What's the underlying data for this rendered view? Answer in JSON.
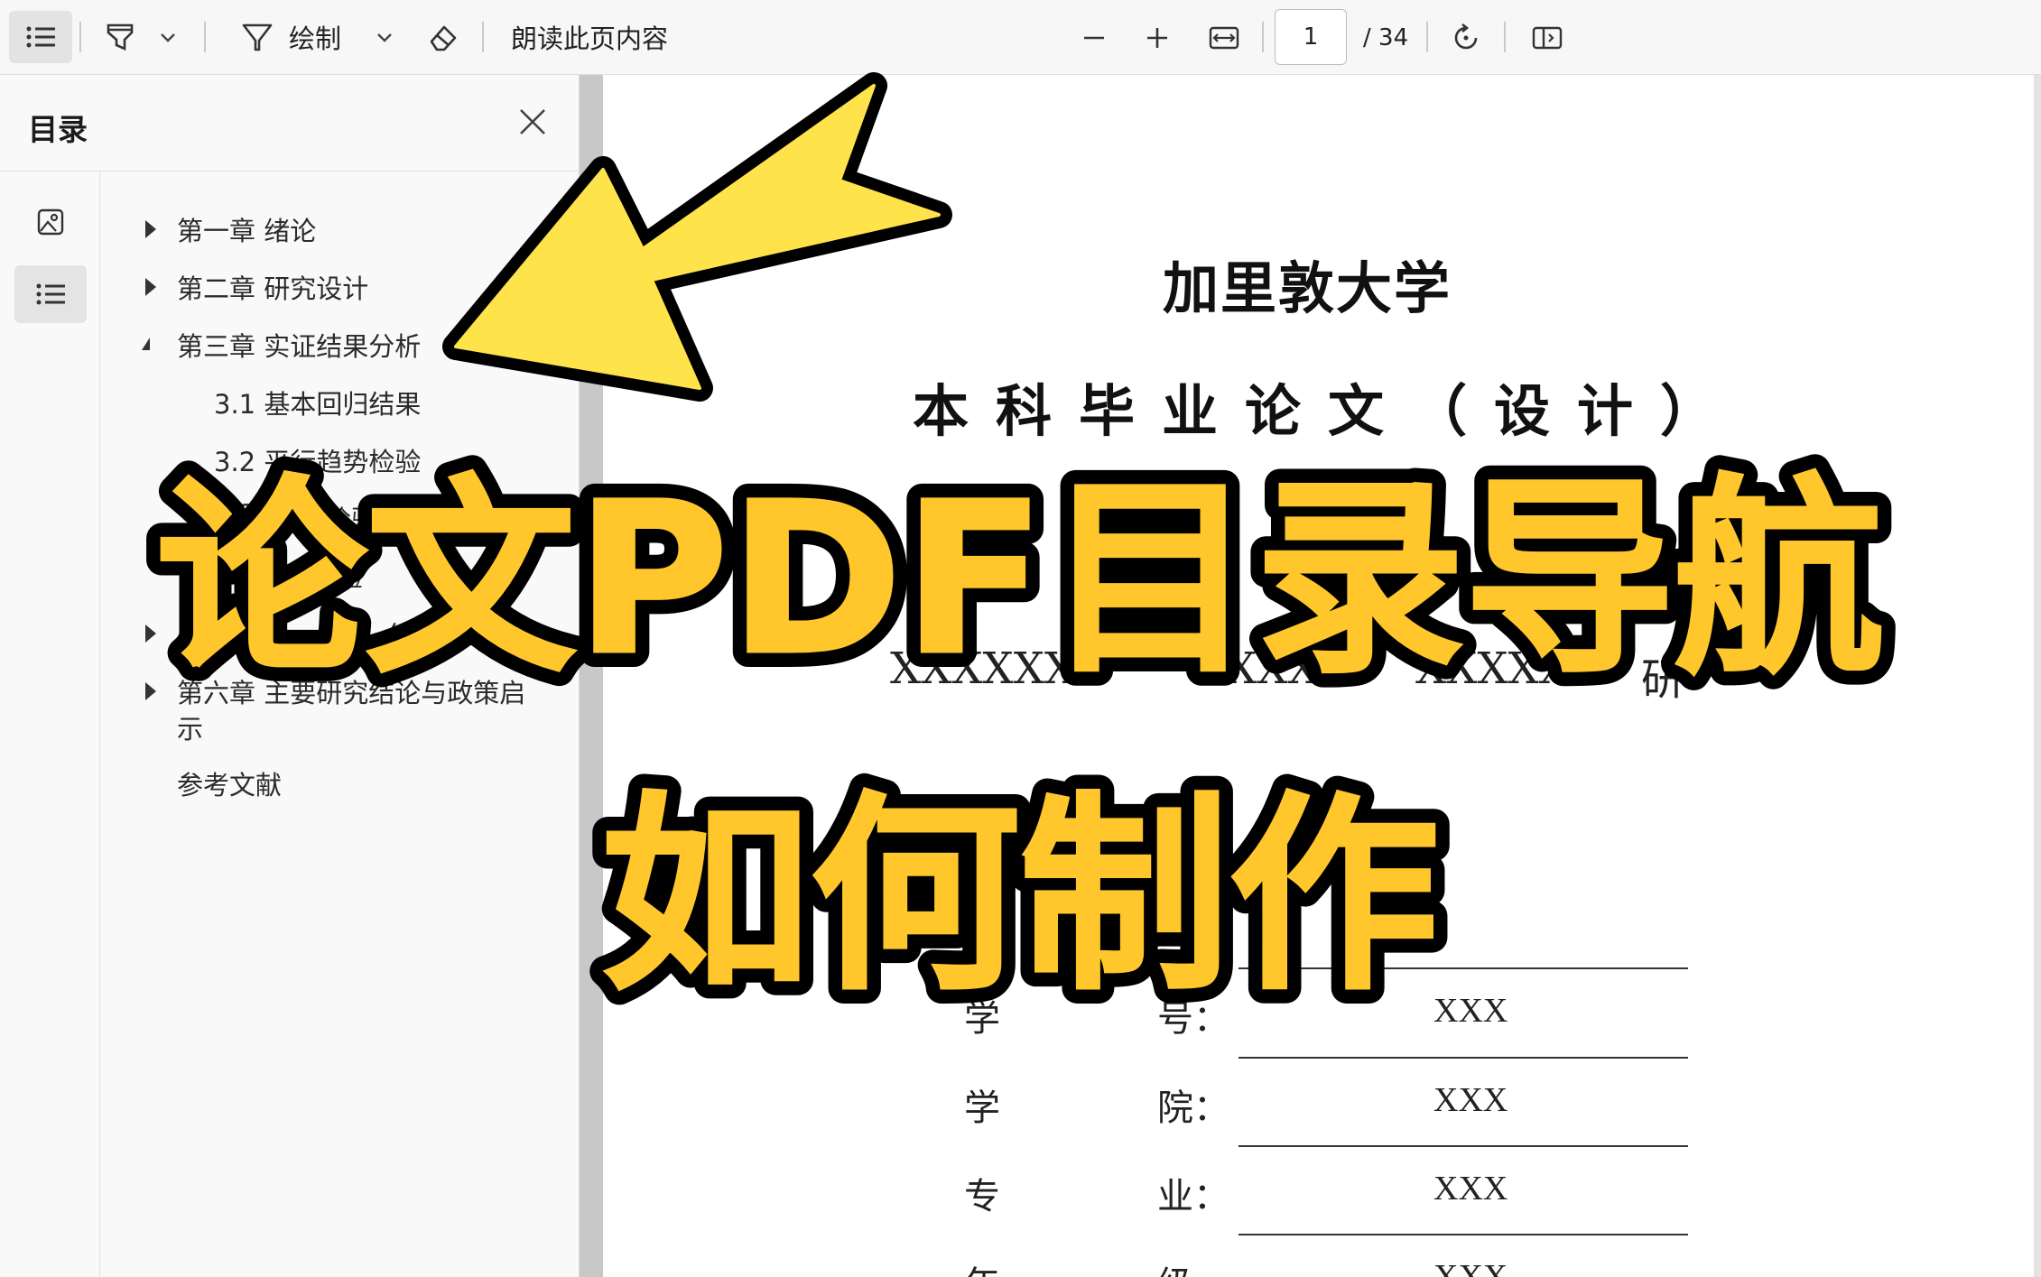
{
  "toolbar": {
    "draw_label": "绘制",
    "read_aloud_label": "朗读此页内容",
    "page_current": "1",
    "page_total": "/ 34",
    "icons": [
      "toc-icon",
      "highlight-icon",
      "chevron-down-icon",
      "draw-pen-icon",
      "eraser-icon",
      "zoom-out-icon",
      "zoom-in-icon",
      "fit-width-icon",
      "rotate-icon",
      "page-view-icon"
    ]
  },
  "sidebar": {
    "title": "目录",
    "items": [
      {
        "label": "第一章 绪论",
        "state": "collapsed"
      },
      {
        "label": "第二章 研究设计",
        "state": "collapsed"
      },
      {
        "label": "第三章 实证结果分析",
        "state": "expanded"
      },
      {
        "label": "3.1 基本回归结果"
      },
      {
        "label": "3.2 平行趋势检验"
      },
      {
        "label": "3.3"
      },
      {
        "label": "性检验"
      },
      {
        "label": "机"
      },
      {
        "label": "验"
      },
      {
        "label": "分析",
        "state": "collapsed"
      },
      {
        "label": "第六章 主要研究结论与政策启",
        "state": "collapsed"
      },
      {
        "label": "示"
      },
      {
        "label": "参考文献"
      }
    ]
  },
  "document": {
    "university": "加里敦大学",
    "thesis_type": "本科毕业论文（设计）",
    "topic_left": "XXXXXX",
    "topic_mid": "XXX",
    "topic_mid2": "XXXXXX",
    "topic_right": "研",
    "fields": [
      {
        "label_a": "学",
        "label_b": "号：",
        "value": "XXX"
      },
      {
        "label_a": "学",
        "label_b": "院：",
        "value": "XXX"
      },
      {
        "label_a": "专",
        "label_b": "业：",
        "value": "XXX"
      },
      {
        "label_a": "年",
        "label_b": "级",
        "value": "XXX"
      }
    ]
  },
  "banner": {
    "line1": "论文PDF目录导航",
    "line2": "如何制作",
    "fill_color": "#FFC72C",
    "stroke_color": "#000000",
    "arrow_color": "#FFE34A"
  }
}
